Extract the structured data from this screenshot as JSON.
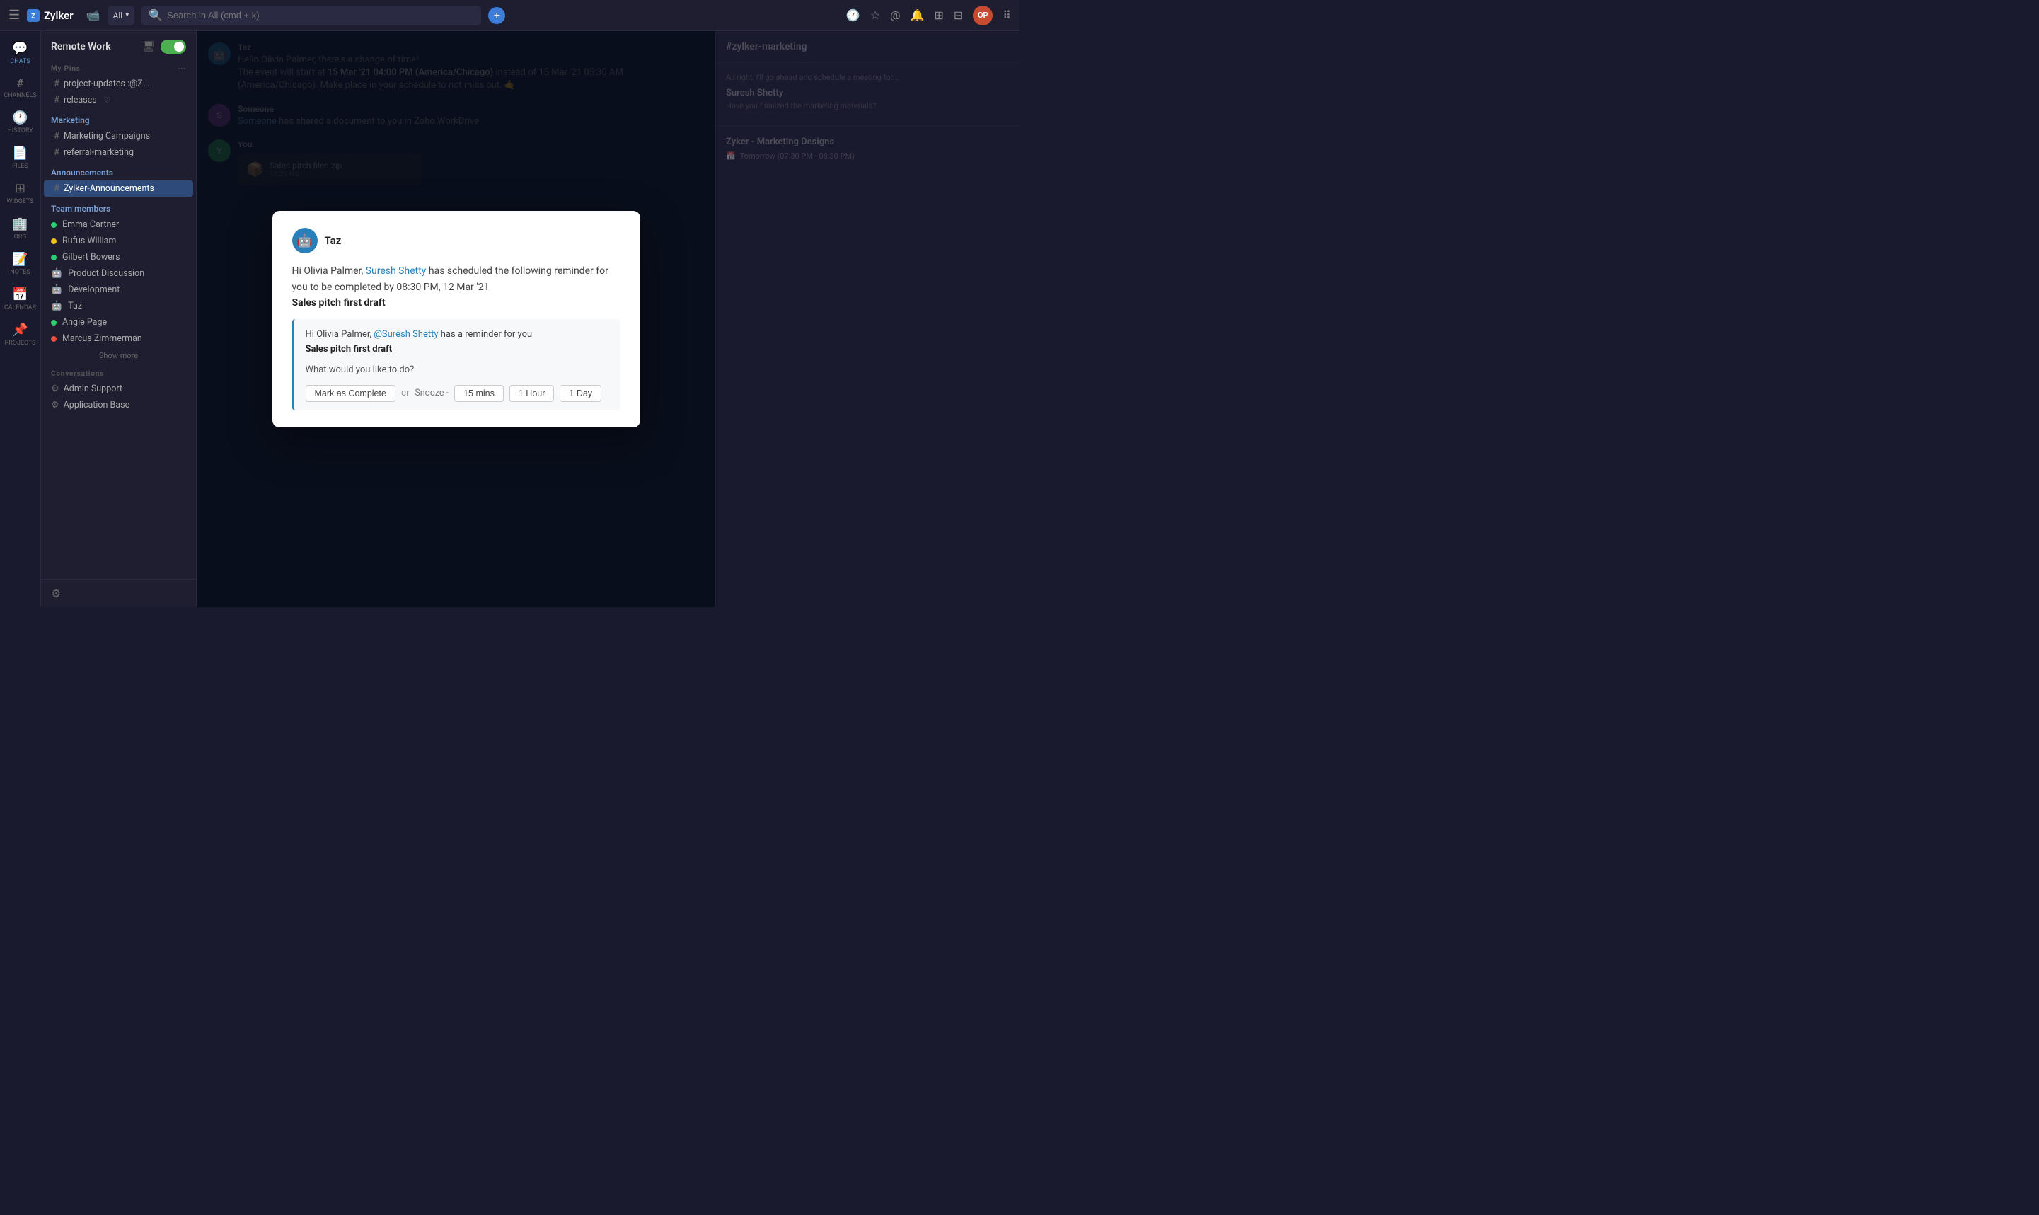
{
  "topbar": {
    "logo_text": "Zylker",
    "search_placeholder": "Search in All (cmd + k)",
    "search_scope": "All",
    "add_button_label": "+"
  },
  "icon_sidebar": {
    "items": [
      {
        "id": "chats",
        "icon": "💬",
        "label": "CHATS"
      },
      {
        "id": "channels",
        "icon": "#",
        "label": "CHANNELS"
      },
      {
        "id": "history",
        "icon": "🕐",
        "label": "HISTORY"
      },
      {
        "id": "files",
        "icon": "📄",
        "label": "FILES"
      },
      {
        "id": "widgets",
        "icon": "⊞",
        "label": "WIDGETS"
      },
      {
        "id": "org",
        "icon": "🏢",
        "label": "ORG"
      },
      {
        "id": "notes",
        "icon": "📝",
        "label": "NOTES"
      },
      {
        "id": "calendar",
        "icon": "📅",
        "label": "CALENDAR"
      },
      {
        "id": "projects",
        "icon": "📌",
        "label": "PROJECTS"
      }
    ]
  },
  "left_panel": {
    "workspace": "Remote Work",
    "my_pins_title": "My Pins",
    "pins": [
      {
        "label": "project-updates :@Z...",
        "type": "channel"
      },
      {
        "label": "releases",
        "type": "channel",
        "pinned": true
      }
    ],
    "groups": [
      {
        "name": "Marketing",
        "channels": [
          {
            "label": "Marketing Campaigns"
          },
          {
            "label": "referral-marketing"
          }
        ]
      },
      {
        "name": "Announcements",
        "channels": [
          {
            "label": "Zylker-Announcements"
          }
        ]
      }
    ],
    "team_members_title": "Team members",
    "members": [
      {
        "name": "Emma Cartner",
        "status": "green"
      },
      {
        "name": "Rufus William",
        "status": "yellow"
      },
      {
        "name": "Gilbert Bowers",
        "status": "green"
      },
      {
        "name": "Product Discussion",
        "status": "icon"
      },
      {
        "name": "Development",
        "status": "icon"
      },
      {
        "name": "Taz",
        "status": "icon"
      },
      {
        "name": "Angie Page",
        "status": "green"
      },
      {
        "name": "Marcus Zimmerman",
        "status": "red"
      }
    ],
    "show_more": "Show more",
    "conversations_title": "Conversations",
    "conversations": [
      {
        "label": "Admin Support"
      },
      {
        "label": "Application Base"
      }
    ]
  },
  "modal": {
    "bot_name": "Taz",
    "body_text": "Hi Olivia Palmer, ",
    "body_link": "Suresh Shetty",
    "body_suffix": " has scheduled the following reminder for you to be completed by 08:30 PM, 12 Mar '21",
    "task_title": "Sales pitch first draft",
    "inner_greeting": "Hi Olivia Palmer, ",
    "inner_link": "@Suresh Shetty",
    "inner_link_suffix": " has a reminder for you",
    "inner_task": "Sales pitch first draft",
    "inner_question": "What would you like to do?",
    "btn_complete": "Mark as Complete",
    "or_text": "or",
    "snooze_label": "Snooze -",
    "snooze_options": [
      "15 mins",
      "1 Hour",
      "1 Day"
    ]
  },
  "chat_messages": [
    {
      "sender": "Taz",
      "avatar_type": "robot",
      "text": "Hello Olivia Palmer, there's a change of time! The event will start at 15 Mar '21 04:00 PM (America/Chicago) instead of 15 Mar '21 05:30 AM (America/Chicago). Make place in your schedule to not miss out. 🤙"
    },
    {
      "sender": "Someone",
      "text": "has shared a document to you in Zoho WorkDrive"
    },
    {
      "sender": "You",
      "attachment": "Sales pitch files.zip",
      "attachment_size": "13.25 MB"
    }
  ],
  "right_panel": {
    "channel": "#zylker-marketing",
    "meeting": "Zyker - Marketing Designs",
    "meeting_time": "Tomorrow (07:30 PM - 08:30 PM)"
  }
}
